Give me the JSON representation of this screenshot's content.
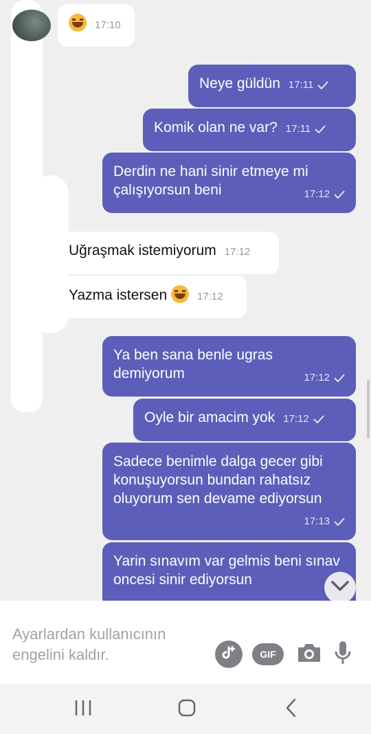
{
  "messages": [
    {
      "dir": "in",
      "text": "",
      "emoji": true,
      "time": "17:10"
    },
    {
      "dir": "out",
      "text": "Neye güldün",
      "time": "17:11"
    },
    {
      "dir": "out",
      "text": "Komik olan ne var?",
      "time": "17:11"
    },
    {
      "dir": "out",
      "text": "Derdin ne hani sinir etmeye mi çalışıyorsun beni",
      "time": "17:12"
    },
    {
      "dir": "in",
      "text": "Uğraşmak istemiyorum",
      "time": "17:12"
    },
    {
      "dir": "in",
      "text": "Yazma istersen",
      "emoji": true,
      "time": "17:12"
    },
    {
      "dir": "out",
      "text": "Ya ben sana benle ugras demiyorum",
      "time": "17:12"
    },
    {
      "dir": "out",
      "text": "Oyle bir amacim yok",
      "time": "17:12"
    },
    {
      "dir": "out",
      "text": "Sadece benimle dalga gecer gibi konuşuyorsun bundan rahatsız oluyorum sen devame ediyorsun",
      "time": "17:13"
    },
    {
      "dir": "out",
      "text": "Yarin sınavım var gelmis beni sınav oncesi sinir ediyorsun",
      "time": ""
    }
  ],
  "input": {
    "placeholder": "Ayarlardan kullanıcının engelini kaldır."
  },
  "icons": {
    "sticker": "sticker-icon",
    "gif": "GIF",
    "camera": "camera-icon",
    "mic": "mic-icon",
    "scroll_down": "chevron-down-icon"
  },
  "colors": {
    "outgoing": "#5c5eba",
    "incoming": "#ffffff",
    "background": "#efefef"
  }
}
